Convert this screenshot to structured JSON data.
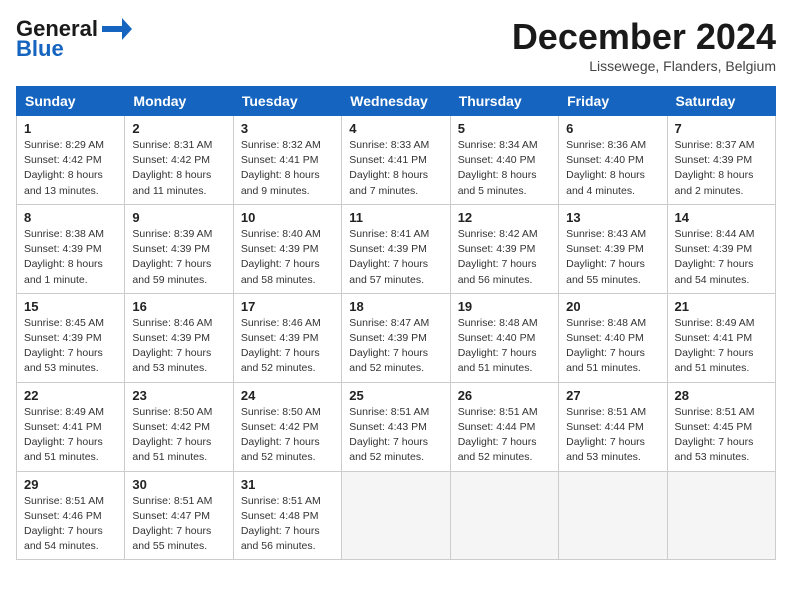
{
  "header": {
    "logo_line1": "General",
    "logo_line2": "Blue",
    "month_title": "December 2024",
    "location": "Lissewege, Flanders, Belgium"
  },
  "weekdays": [
    "Sunday",
    "Monday",
    "Tuesday",
    "Wednesday",
    "Thursday",
    "Friday",
    "Saturday"
  ],
  "weeks": [
    [
      {
        "day": "1",
        "sunrise": "8:29 AM",
        "sunset": "4:42 PM",
        "daylight": "8 hours and 13 minutes."
      },
      {
        "day": "2",
        "sunrise": "8:31 AM",
        "sunset": "4:42 PM",
        "daylight": "8 hours and 11 minutes."
      },
      {
        "day": "3",
        "sunrise": "8:32 AM",
        "sunset": "4:41 PM",
        "daylight": "8 hours and 9 minutes."
      },
      {
        "day": "4",
        "sunrise": "8:33 AM",
        "sunset": "4:41 PM",
        "daylight": "8 hours and 7 minutes."
      },
      {
        "day": "5",
        "sunrise": "8:34 AM",
        "sunset": "4:40 PM",
        "daylight": "8 hours and 5 minutes."
      },
      {
        "day": "6",
        "sunrise": "8:36 AM",
        "sunset": "4:40 PM",
        "daylight": "8 hours and 4 minutes."
      },
      {
        "day": "7",
        "sunrise": "8:37 AM",
        "sunset": "4:39 PM",
        "daylight": "8 hours and 2 minutes."
      }
    ],
    [
      {
        "day": "8",
        "sunrise": "8:38 AM",
        "sunset": "4:39 PM",
        "daylight": "8 hours and 1 minute."
      },
      {
        "day": "9",
        "sunrise": "8:39 AM",
        "sunset": "4:39 PM",
        "daylight": "7 hours and 59 minutes."
      },
      {
        "day": "10",
        "sunrise": "8:40 AM",
        "sunset": "4:39 PM",
        "daylight": "7 hours and 58 minutes."
      },
      {
        "day": "11",
        "sunrise": "8:41 AM",
        "sunset": "4:39 PM",
        "daylight": "7 hours and 57 minutes."
      },
      {
        "day": "12",
        "sunrise": "8:42 AM",
        "sunset": "4:39 PM",
        "daylight": "7 hours and 56 minutes."
      },
      {
        "day": "13",
        "sunrise": "8:43 AM",
        "sunset": "4:39 PM",
        "daylight": "7 hours and 55 minutes."
      },
      {
        "day": "14",
        "sunrise": "8:44 AM",
        "sunset": "4:39 PM",
        "daylight": "7 hours and 54 minutes."
      }
    ],
    [
      {
        "day": "15",
        "sunrise": "8:45 AM",
        "sunset": "4:39 PM",
        "daylight": "7 hours and 53 minutes."
      },
      {
        "day": "16",
        "sunrise": "8:46 AM",
        "sunset": "4:39 PM",
        "daylight": "7 hours and 53 minutes."
      },
      {
        "day": "17",
        "sunrise": "8:46 AM",
        "sunset": "4:39 PM",
        "daylight": "7 hours and 52 minutes."
      },
      {
        "day": "18",
        "sunrise": "8:47 AM",
        "sunset": "4:39 PM",
        "daylight": "7 hours and 52 minutes."
      },
      {
        "day": "19",
        "sunrise": "8:48 AM",
        "sunset": "4:40 PM",
        "daylight": "7 hours and 51 minutes."
      },
      {
        "day": "20",
        "sunrise": "8:48 AM",
        "sunset": "4:40 PM",
        "daylight": "7 hours and 51 minutes."
      },
      {
        "day": "21",
        "sunrise": "8:49 AM",
        "sunset": "4:41 PM",
        "daylight": "7 hours and 51 minutes."
      }
    ],
    [
      {
        "day": "22",
        "sunrise": "8:49 AM",
        "sunset": "4:41 PM",
        "daylight": "7 hours and 51 minutes."
      },
      {
        "day": "23",
        "sunrise": "8:50 AM",
        "sunset": "4:42 PM",
        "daylight": "7 hours and 51 minutes."
      },
      {
        "day": "24",
        "sunrise": "8:50 AM",
        "sunset": "4:42 PM",
        "daylight": "7 hours and 52 minutes."
      },
      {
        "day": "25",
        "sunrise": "8:51 AM",
        "sunset": "4:43 PM",
        "daylight": "7 hours and 52 minutes."
      },
      {
        "day": "26",
        "sunrise": "8:51 AM",
        "sunset": "4:44 PM",
        "daylight": "7 hours and 52 minutes."
      },
      {
        "day": "27",
        "sunrise": "8:51 AM",
        "sunset": "4:44 PM",
        "daylight": "7 hours and 53 minutes."
      },
      {
        "day": "28",
        "sunrise": "8:51 AM",
        "sunset": "4:45 PM",
        "daylight": "7 hours and 53 minutes."
      }
    ],
    [
      {
        "day": "29",
        "sunrise": "8:51 AM",
        "sunset": "4:46 PM",
        "daylight": "7 hours and 54 minutes."
      },
      {
        "day": "30",
        "sunrise": "8:51 AM",
        "sunset": "4:47 PM",
        "daylight": "7 hours and 55 minutes."
      },
      {
        "day": "31",
        "sunrise": "8:51 AM",
        "sunset": "4:48 PM",
        "daylight": "7 hours and 56 minutes."
      },
      null,
      null,
      null,
      null
    ]
  ],
  "labels": {
    "sunrise_prefix": "Sunrise: ",
    "sunset_prefix": "Sunset: ",
    "daylight_prefix": "Daylight: "
  }
}
